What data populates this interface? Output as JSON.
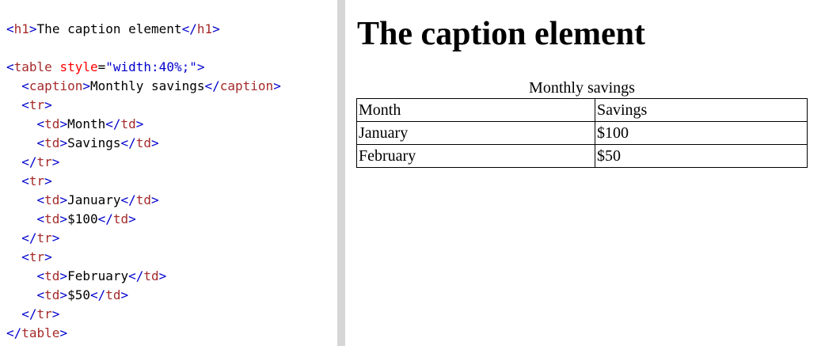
{
  "editor": {
    "lines": [
      [
        {
          "t": "<",
          "k": "br"
        },
        {
          "t": "h1",
          "k": "tag"
        },
        {
          "t": ">",
          "k": "br"
        },
        {
          "t": "The caption element",
          "k": "txt"
        },
        {
          "t": "</",
          "k": "br"
        },
        {
          "t": "h1",
          "k": "tag"
        },
        {
          "t": ">",
          "k": "br"
        }
      ],
      [],
      [
        {
          "t": "<",
          "k": "br"
        },
        {
          "t": "table",
          "k": "tag"
        },
        {
          "t": " style",
          "k": "attr"
        },
        {
          "t": "=",
          "k": "txt"
        },
        {
          "t": "\"width:40%;\"",
          "k": "val"
        },
        {
          "t": ">",
          "k": "br"
        }
      ],
      [
        {
          "t": "  ",
          "k": "txt"
        },
        {
          "t": "<",
          "k": "br"
        },
        {
          "t": "caption",
          "k": "tag"
        },
        {
          "t": ">",
          "k": "br"
        },
        {
          "t": "Monthly savings",
          "k": "txt"
        },
        {
          "t": "</",
          "k": "br"
        },
        {
          "t": "caption",
          "k": "tag"
        },
        {
          "t": ">",
          "k": "br"
        }
      ],
      [
        {
          "t": "  ",
          "k": "txt"
        },
        {
          "t": "<",
          "k": "br"
        },
        {
          "t": "tr",
          "k": "tag"
        },
        {
          "t": ">",
          "k": "br"
        }
      ],
      [
        {
          "t": "    ",
          "k": "txt"
        },
        {
          "t": "<",
          "k": "br"
        },
        {
          "t": "td",
          "k": "tag"
        },
        {
          "t": ">",
          "k": "br"
        },
        {
          "t": "Month",
          "k": "txt"
        },
        {
          "t": "</",
          "k": "br"
        },
        {
          "t": "td",
          "k": "tag"
        },
        {
          "t": ">",
          "k": "br"
        }
      ],
      [
        {
          "t": "    ",
          "k": "txt"
        },
        {
          "t": "<",
          "k": "br"
        },
        {
          "t": "td",
          "k": "tag"
        },
        {
          "t": ">",
          "k": "br"
        },
        {
          "t": "Savings",
          "k": "txt"
        },
        {
          "t": "</",
          "k": "br"
        },
        {
          "t": "td",
          "k": "tag"
        },
        {
          "t": ">",
          "k": "br"
        }
      ],
      [
        {
          "t": "  ",
          "k": "txt"
        },
        {
          "t": "</",
          "k": "br"
        },
        {
          "t": "tr",
          "k": "tag"
        },
        {
          "t": ">",
          "k": "br"
        }
      ],
      [
        {
          "t": "  ",
          "k": "txt"
        },
        {
          "t": "<",
          "k": "br"
        },
        {
          "t": "tr",
          "k": "tag"
        },
        {
          "t": ">",
          "k": "br"
        }
      ],
      [
        {
          "t": "    ",
          "k": "txt"
        },
        {
          "t": "<",
          "k": "br"
        },
        {
          "t": "td",
          "k": "tag"
        },
        {
          "t": ">",
          "k": "br"
        },
        {
          "t": "January",
          "k": "txt"
        },
        {
          "t": "</",
          "k": "br"
        },
        {
          "t": "td",
          "k": "tag"
        },
        {
          "t": ">",
          "k": "br"
        }
      ],
      [
        {
          "t": "    ",
          "k": "txt"
        },
        {
          "t": "<",
          "k": "br"
        },
        {
          "t": "td",
          "k": "tag"
        },
        {
          "t": ">",
          "k": "br"
        },
        {
          "t": "$100",
          "k": "txt"
        },
        {
          "t": "</",
          "k": "br"
        },
        {
          "t": "td",
          "k": "tag"
        },
        {
          "t": ">",
          "k": "br"
        }
      ],
      [
        {
          "t": "  ",
          "k": "txt"
        },
        {
          "t": "</",
          "k": "br"
        },
        {
          "t": "tr",
          "k": "tag"
        },
        {
          "t": ">",
          "k": "br"
        }
      ],
      [
        {
          "t": "  ",
          "k": "txt"
        },
        {
          "t": "<",
          "k": "br"
        },
        {
          "t": "tr",
          "k": "tag"
        },
        {
          "t": ">",
          "k": "br"
        }
      ],
      [
        {
          "t": "    ",
          "k": "txt"
        },
        {
          "t": "<",
          "k": "br"
        },
        {
          "t": "td",
          "k": "tag"
        },
        {
          "t": ">",
          "k": "br"
        },
        {
          "t": "February",
          "k": "txt"
        },
        {
          "t": "</",
          "k": "br"
        },
        {
          "t": "td",
          "k": "tag"
        },
        {
          "t": ">",
          "k": "br"
        }
      ],
      [
        {
          "t": "    ",
          "k": "txt"
        },
        {
          "t": "<",
          "k": "br"
        },
        {
          "t": "td",
          "k": "tag"
        },
        {
          "t": ">",
          "k": "br"
        },
        {
          "t": "$50",
          "k": "txt"
        },
        {
          "t": "</",
          "k": "br"
        },
        {
          "t": "td",
          "k": "tag"
        },
        {
          "t": ">",
          "k": "br"
        }
      ],
      [
        {
          "t": "  ",
          "k": "txt"
        },
        {
          "t": "</",
          "k": "br"
        },
        {
          "t": "tr",
          "k": "tag"
        },
        {
          "t": ">",
          "k": "br"
        }
      ],
      [
        {
          "t": "</",
          "k": "br"
        },
        {
          "t": "table",
          "k": "tag"
        },
        {
          "t": ">",
          "k": "br"
        }
      ]
    ]
  },
  "result": {
    "heading": "The caption element",
    "caption": "Monthly savings",
    "rows": [
      [
        "Month",
        "Savings"
      ],
      [
        "January",
        "$100"
      ],
      [
        "February",
        "$50"
      ]
    ]
  },
  "colors": {
    "tag": "#a52a2a",
    "bracket": "#0000cd",
    "attribute": "#ff0000",
    "value": "#0000cd",
    "divider": "#d6d6d6"
  }
}
